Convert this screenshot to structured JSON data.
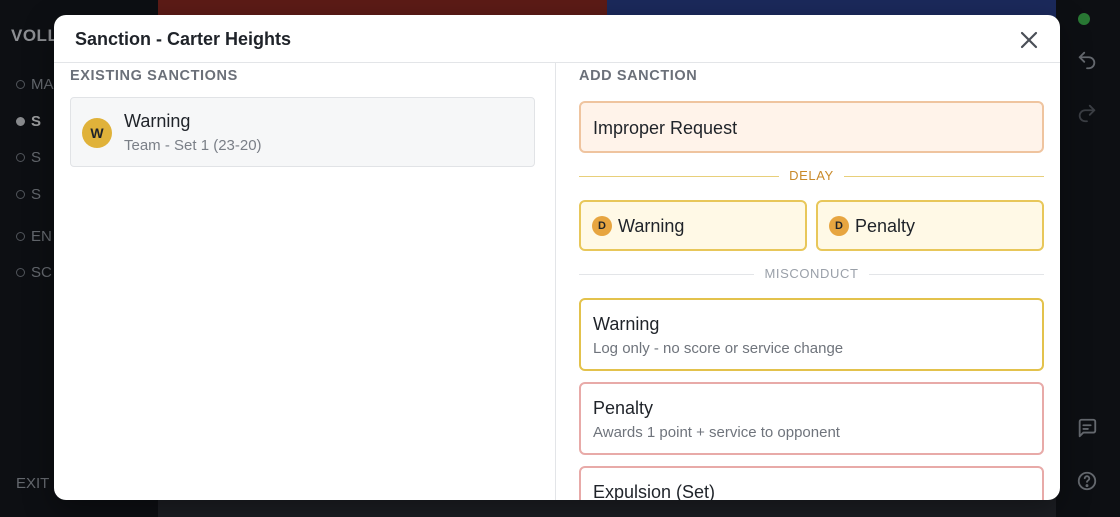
{
  "background": {
    "brand": "VOLL",
    "nav": [
      {
        "label": "MA",
        "active": false
      },
      {
        "label": "S",
        "active": true
      },
      {
        "label": "S",
        "active": false
      },
      {
        "label": "S",
        "active": false
      },
      {
        "label": "EN",
        "active": false
      },
      {
        "label": "SC",
        "active": false
      }
    ],
    "exit": "EXIT",
    "team_colors": {
      "left": "#8e2a22",
      "right": "#2a3f8c"
    },
    "status_color": "#3fb950"
  },
  "modal": {
    "title": "Sanction - Carter Heights",
    "close_icon": "close-icon",
    "existing": {
      "heading": "EXISTING SANCTIONS",
      "items": [
        {
          "badge": "W",
          "title": "Warning",
          "subtitle": "Team - Set 1 (23-20)"
        }
      ]
    },
    "add": {
      "heading": "ADD SANCTION",
      "improper_request": "Improper Request",
      "delay_label": "DELAY",
      "delay_options": [
        {
          "badge": "D",
          "label": "Warning"
        },
        {
          "badge": "D",
          "label": "Penalty"
        }
      ],
      "misconduct_label": "MISCONDUCT",
      "misconduct_options": [
        {
          "title": "Warning",
          "subtitle": "Log only - no score or service change"
        },
        {
          "title": "Penalty",
          "subtitle": "Awards 1 point + service to opponent"
        },
        {
          "title": "Expulsion (Set)",
          "subtitle": ""
        }
      ]
    }
  },
  "colors": {
    "warning_badge": "#e0b23a",
    "delay_badge": "#e7a540",
    "improper_bg": "#fff3ea",
    "delay_border": "#e8c75a",
    "penalty_border": "#e8aaa8"
  }
}
